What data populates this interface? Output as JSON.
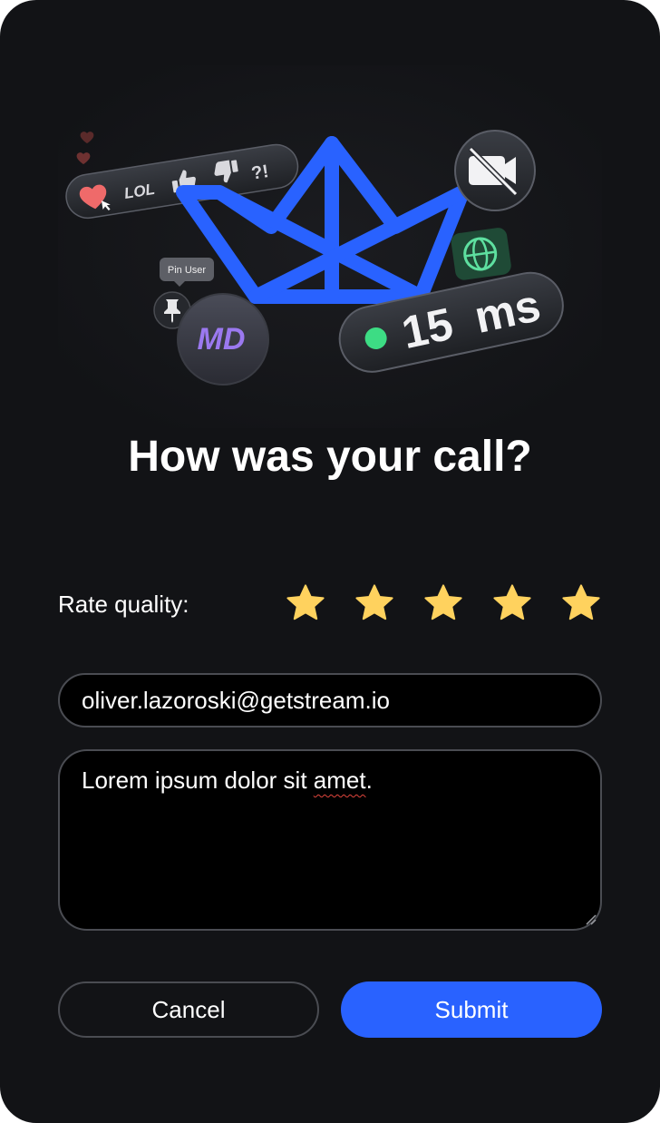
{
  "dialog": {
    "title": "How was your call?",
    "rating": {
      "label": "Rate quality:",
      "value": 5,
      "max": 5,
      "star_color": "#ffd25e"
    },
    "email": {
      "value": "oliver.lazoroski@getstream.io"
    },
    "message": {
      "prefix": "Lorem ipsum dolor sit ",
      "misspelled": "amet",
      "suffix": "."
    },
    "buttons": {
      "cancel": "Cancel",
      "submit": "Submit"
    },
    "colors": {
      "background": "#121316",
      "accent": "#2962ff",
      "field_border": "#4a4c52"
    }
  },
  "illustration": {
    "reactions": [
      "LOL",
      "?!"
    ],
    "pin_tooltip": "Pin User",
    "avatar_initials": "MD",
    "latency_value": "15",
    "latency_unit": "ms",
    "icons": [
      "heart-icon",
      "thumbs-up-icon",
      "thumbs-down-icon",
      "video-off-icon",
      "globe-icon",
      "pin-icon"
    ]
  }
}
